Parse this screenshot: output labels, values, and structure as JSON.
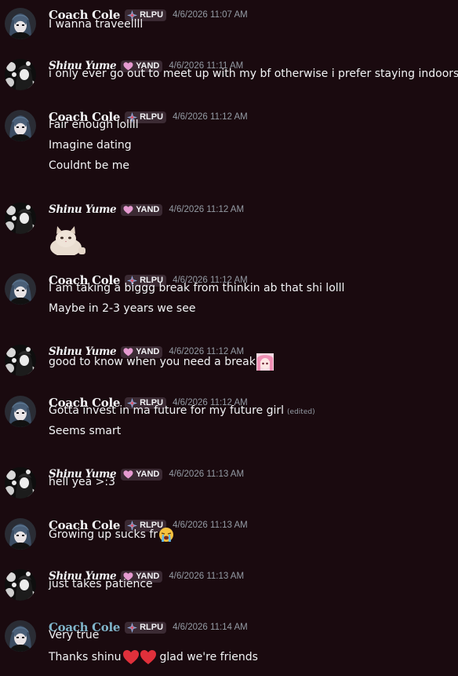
{
  "users": {
    "coach": {
      "name": "Coach Cole",
      "tag": "RLPU"
    },
    "shinu": {
      "name": "Shinu Yume",
      "tag": "YAND"
    }
  },
  "colors": {
    "background": "#1a0a0f",
    "text": "#f2f3f5",
    "timestamp": "#949ba4",
    "tag_bg": "#3b2a33",
    "teal_name": "#7fb4c9",
    "heart": "#e0303b"
  },
  "messages": [
    {
      "user": "Coach Cole",
      "tag": "RLPU",
      "time": "4/6/2026 11:07 AM",
      "lines": [
        "I wanna traveellll"
      ]
    },
    {
      "user": "Shinu Yume",
      "tag": "YAND",
      "time": "4/6/2026 11:11 AM",
      "lines": [
        "i only ever go out to meet up with my bf otherwise i prefer staying indoors ;-;"
      ]
    },
    {
      "user": "Coach Cole",
      "tag": "RLPU",
      "time": "4/6/2026 11:12 AM",
      "lines": [
        "Fair enough lollll",
        "Imagine dating",
        "Couldnt be me"
      ]
    },
    {
      "user": "Shinu Yume",
      "tag": "YAND",
      "time": "4/6/2026 11:12 AM",
      "lines": [],
      "sticker": "cat-sticker"
    },
    {
      "user": "Coach Cole",
      "tag": "RLPU",
      "time": "4/6/2026 11:12 AM",
      "lines": [
        "I am taking a biggg break from thinkin ab that shi lolll",
        "Maybe in 2-3 years we see"
      ]
    },
    {
      "user": "Shinu Yume",
      "tag": "YAND",
      "time": "4/6/2026 11:12 AM",
      "lines": [
        "good to know when you need a break"
      ],
      "emoji": "anime-girl-emoji"
    },
    {
      "user": "Coach Cole",
      "tag": "RLPU",
      "time": "4/6/2026 11:12 AM",
      "lines": [
        "Gotta invest in ma future for my future girl",
        "Seems smart"
      ],
      "edited": "(edited)"
    },
    {
      "user": "Shinu Yume",
      "tag": "YAND",
      "time": "4/6/2026 11:13 AM",
      "lines": [
        "hell yea >:3"
      ]
    },
    {
      "user": "Coach Cole",
      "tag": "RLPU",
      "time": "4/6/2026 11:13 AM",
      "lines": [
        "Growing up sucks fr"
      ],
      "emoji": "crying-face-emoji"
    },
    {
      "user": "Shinu Yume",
      "tag": "YAND",
      "time": "4/6/2026 11:13 AM",
      "lines": [
        "just takes patience"
      ]
    },
    {
      "user": "Coach Cole",
      "tag": "RLPU",
      "time": "4/6/2026 11:14 AM",
      "lines": [
        "Very true",
        "Thanks shinu",
        "glad we're friends"
      ],
      "emoji": "red-heart-emoji"
    }
  ]
}
